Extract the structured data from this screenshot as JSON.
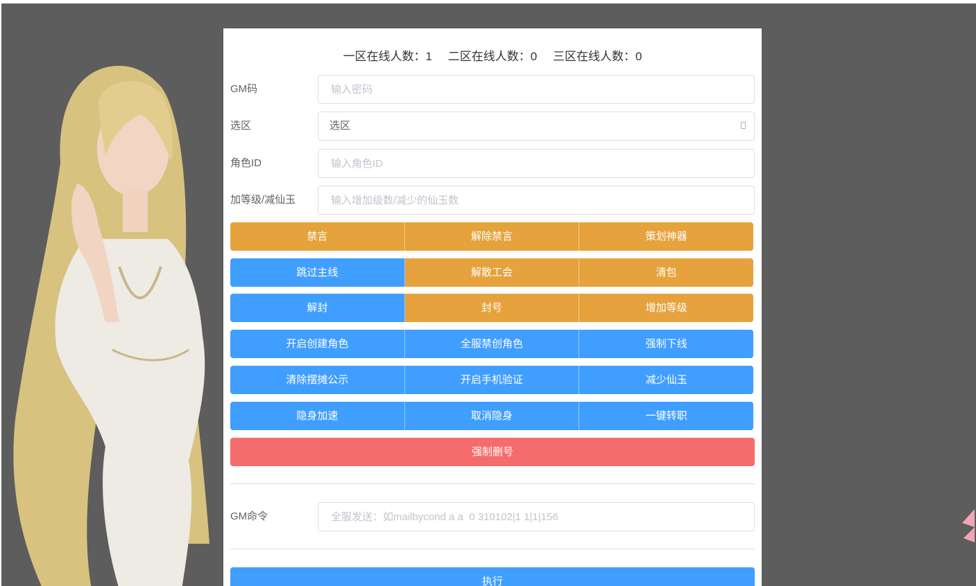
{
  "online": {
    "zone1": "一区在线人数：1",
    "zone2": "二区在线人数：0",
    "zone3": "三区在线人数：0"
  },
  "form": {
    "gm_code": {
      "label": "GM码",
      "placeholder": "输入密码"
    },
    "zone": {
      "label": "选区",
      "value": "选区"
    },
    "role_id": {
      "label": "角色ID",
      "placeholder": "输入角色ID"
    },
    "level_jade": {
      "label": "加等级/减仙玉",
      "placeholder": "输入增加级数/减少的仙玉数"
    }
  },
  "buttons": {
    "row1": [
      "禁言",
      "解除禁言",
      "策划神器"
    ],
    "row2": [
      "跳过主线",
      "解散工会",
      "清包"
    ],
    "row3": [
      "解封",
      "封号",
      "增加等级"
    ],
    "row4": [
      "开启创建角色",
      "全服禁创角色",
      "强制下线"
    ],
    "row5": [
      "清除摆摊公示",
      "开启手机验证",
      "减少仙玉"
    ],
    "row6": [
      "隐身加速",
      "取消隐身",
      "一键转职"
    ],
    "row7": [
      "强制删号"
    ]
  },
  "gm_command": {
    "label": "GM命令",
    "placeholder": "全服发送：如mailbycond a a  0 310102|1 1|1|156"
  },
  "execute_label": "执行",
  "colors": {
    "orange": "#e6a23c",
    "blue": "#409eff",
    "red": "#f56c6c",
    "background": "#5d5d5d"
  }
}
